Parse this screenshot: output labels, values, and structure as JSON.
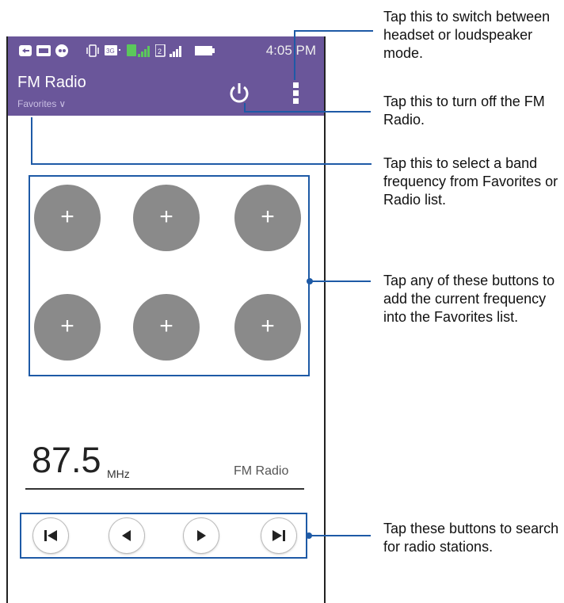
{
  "status_bar": {
    "time": "4:05 PM",
    "icons": [
      "notification-icon",
      "message-icon",
      "chat-icon",
      "vibrate-icon",
      "3g-icon",
      "signal-icon",
      "signal-icon",
      "battery-icon"
    ]
  },
  "app": {
    "title": "FM Radio",
    "dropdown_label": "Favorites",
    "dropdown_chevron": "∨"
  },
  "favorites": {
    "buttons": [
      "+",
      "+",
      "+",
      "+",
      "+",
      "+"
    ]
  },
  "tuner": {
    "frequency": "87.5",
    "unit": "MHz",
    "station_label": "FM Radio"
  },
  "controls": [
    "skip-previous-icon",
    "seek-backward-icon",
    "seek-forward-icon",
    "skip-next-icon"
  ],
  "callouts": {
    "overflow": "Tap this to switch between headset or loudspeaker mode.",
    "power": "Tap this to turn off the FM Radio.",
    "band": "Tap this to select a band frequency from Favorites or Radio list.",
    "favorites": "Tap any of these buttons to add the current frequency into the Favorites list.",
    "search": "Tap these buttons to search for radio stations."
  },
  "colors": {
    "appbar": "#6a569a",
    "favorite_button": "#8a8a8a",
    "callout": "#1e5aa6"
  }
}
